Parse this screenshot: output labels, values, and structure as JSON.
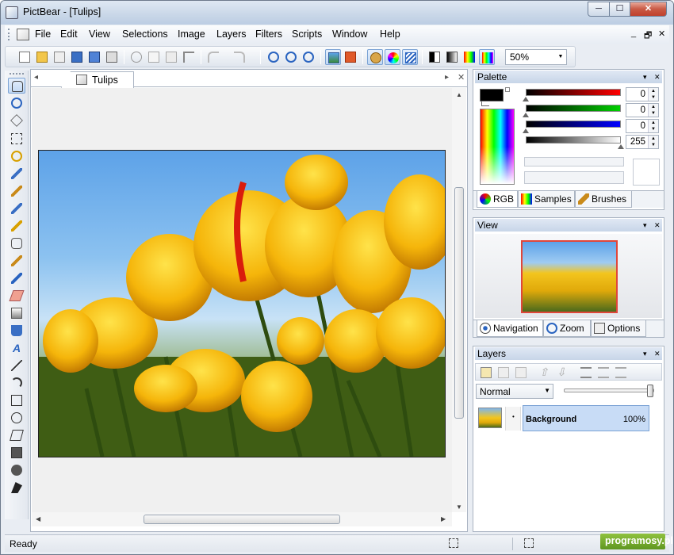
{
  "window": {
    "title": "PictBear - [Tulips]",
    "minimize": "─",
    "maximize": "☐",
    "close": "✕"
  },
  "menu": {
    "items": [
      "File",
      "Edit",
      "View",
      "Selections",
      "Image",
      "Layers",
      "Filters",
      "Scripts",
      "Window",
      "Help"
    ],
    "mdi": [
      "_",
      "🗗",
      "✕"
    ]
  },
  "toolbar": {
    "zoom": "50%"
  },
  "document": {
    "tab_label": "Tulips",
    "close": "✕",
    "prev": "◂",
    "next": "▸"
  },
  "palette": {
    "title": "Palette",
    "red": "0",
    "green": "0",
    "blue": "0",
    "alpha": "255",
    "tabs": [
      "RGB",
      "Samples",
      "Brushes"
    ],
    "colors": {
      "red": "#ff0000",
      "green": "#00d200",
      "blue": "#0000ff"
    }
  },
  "view": {
    "title": "View",
    "tabs": [
      "Navigation",
      "Zoom",
      "Options"
    ]
  },
  "layers": {
    "title": "Layers",
    "blend_mode": "Normal",
    "opacity_level": 1.0,
    "items": [
      {
        "name": "Background",
        "opacity": "100%"
      }
    ]
  },
  "panel_controls": {
    "pin": "▾",
    "close": "✕"
  },
  "status": {
    "text": "Ready"
  },
  "watermark": "programosy.pl"
}
